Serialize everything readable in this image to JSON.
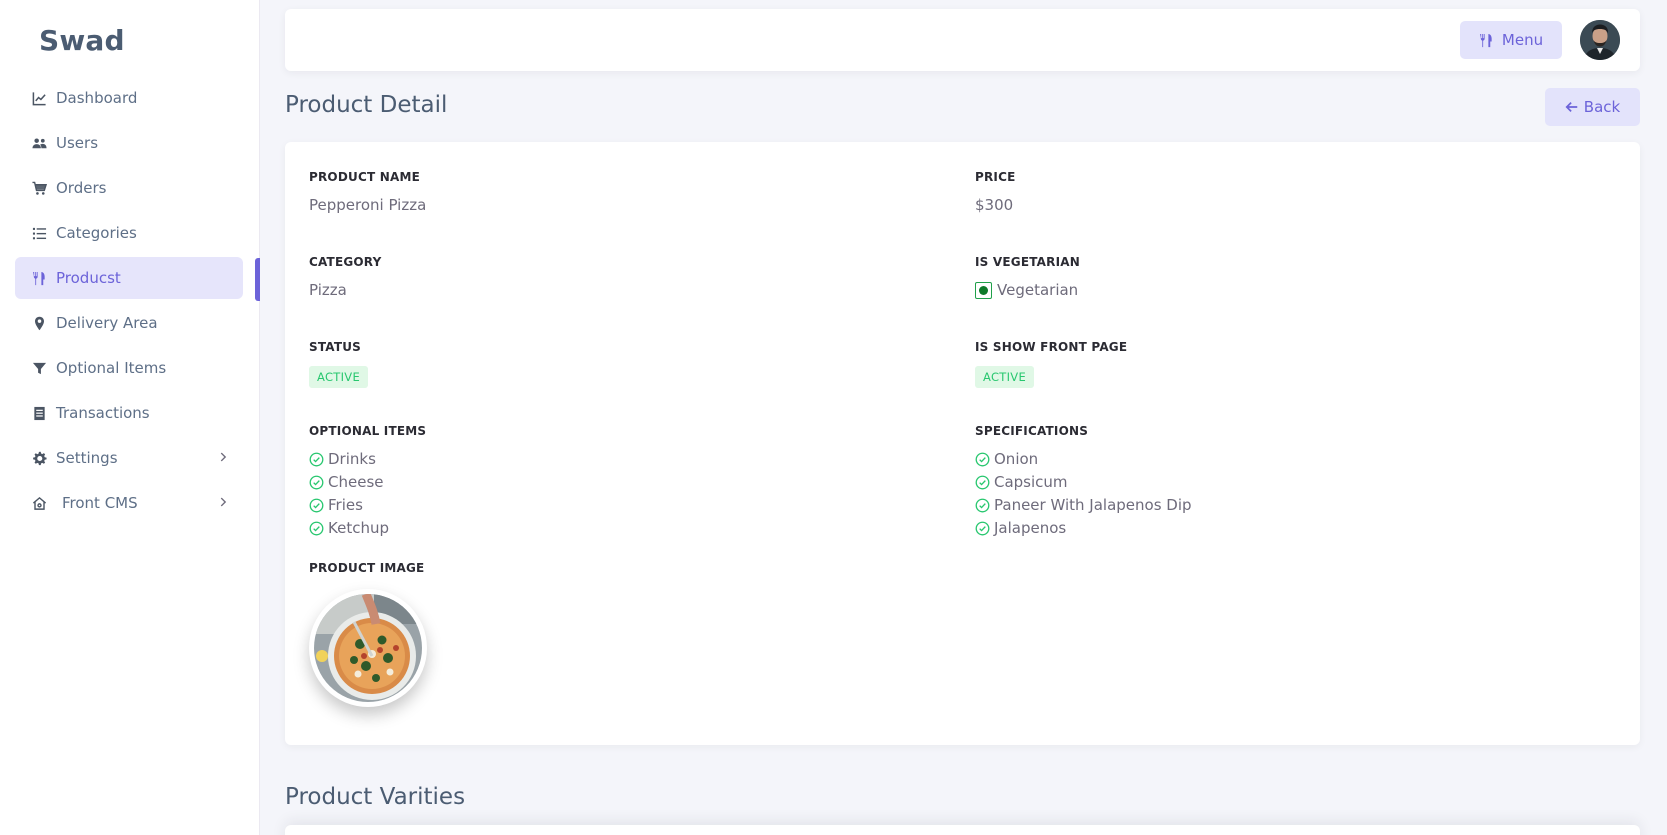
{
  "app": {
    "brand": "Swad"
  },
  "sidebar": {
    "items": [
      {
        "label": "Dashboard",
        "icon": "chart-line-icon"
      },
      {
        "label": "Users",
        "icon": "users-icon"
      },
      {
        "label": "Orders",
        "icon": "cart-icon"
      },
      {
        "label": "Categories",
        "icon": "list-icon"
      },
      {
        "label": "Producst",
        "icon": "utensils-icon",
        "active": true
      },
      {
        "label": "Delivery Area",
        "icon": "map-pin-icon"
      },
      {
        "label": "Optional Items",
        "icon": "filter-icon"
      },
      {
        "label": "Transactions",
        "icon": "receipt-icon"
      },
      {
        "label": "Settings",
        "icon": "gear-icon",
        "has_submenu": true
      },
      {
        "label": "Front CMS",
        "icon": "home-icon",
        "has_submenu": true
      }
    ]
  },
  "topbar": {
    "menu_label": "Menu"
  },
  "page": {
    "title": "Product Detail",
    "back_label": "Back"
  },
  "product": {
    "name_label": "PRODUCT NAME",
    "name": "Pepperoni Pizza",
    "price_label": "PRICE",
    "price": "$300",
    "category_label": "CATEGORY",
    "category": "Pizza",
    "vegetarian_label": "IS VEGETARIAN",
    "vegetarian": "Vegetarian",
    "status_label": "STATUS",
    "status": "ACTIVE",
    "front_page_label": "IS SHOW FRONT PAGE",
    "front_page": "ACTIVE",
    "optional_label": "OPTIONAL ITEMS",
    "optional_items": [
      "Drinks",
      "Cheese",
      "Fries",
      "Ketchup"
    ],
    "specs_label": "SPECIFICATIONS",
    "specifications": [
      "Onion",
      "Capsicum",
      "Paneer With Jalapenos Dip",
      "Jalapenos"
    ],
    "image_label": "PRODUCT IMAGE"
  },
  "varieties": {
    "title": "Product Varities"
  },
  "colors": {
    "accent": "#6c63d9",
    "success": "#28c76f",
    "veg": "#0f7a2a"
  }
}
